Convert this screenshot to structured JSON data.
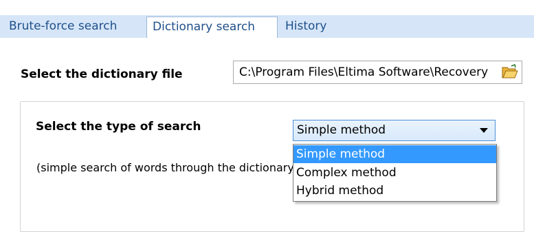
{
  "tabs": [
    {
      "label": "Brute-force search",
      "active": false
    },
    {
      "label": "Dictionary search",
      "active": true
    },
    {
      "label": "History",
      "active": false
    }
  ],
  "dictionary": {
    "label": "Select the dictionary file",
    "path_value": "C:\\Program Files\\Eltima Software\\Recovery",
    "browse_icon": "folder-open-icon"
  },
  "search_type": {
    "label": "Select the type of search",
    "selected": "Simple method",
    "options": [
      "Simple method",
      "Complex method",
      "Hybrid method"
    ],
    "highlighted": "Simple method",
    "description": "(simple search of words through the dictionary"
  },
  "colors": {
    "tabbar_bg": "#d6e6f8",
    "tab_text": "#1f4f8a",
    "highlight": "#3399ff",
    "select_border": "#4a8fd8"
  }
}
